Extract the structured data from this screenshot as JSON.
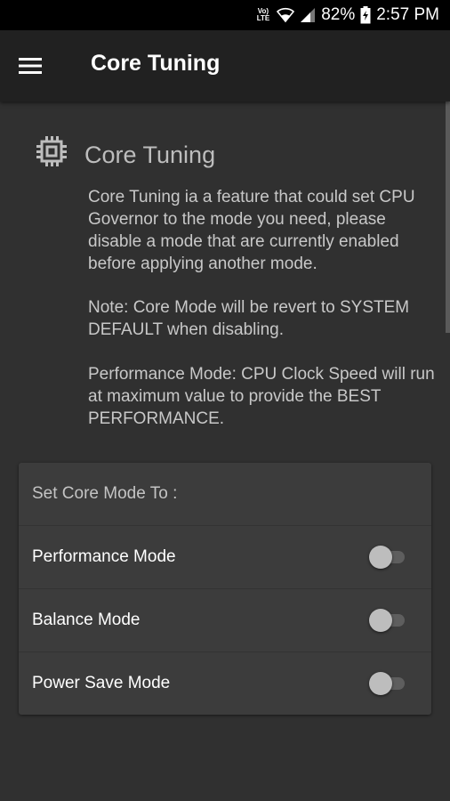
{
  "status_bar": {
    "volte_top": "Vo)",
    "volte_bottom": "LTE",
    "wifi_icon": "wifi-icon",
    "signal_icon": "signal-icon",
    "battery_percent": "82%",
    "battery_icon": "battery-charging-icon",
    "time": "2:57 PM"
  },
  "app_bar": {
    "menu_icon": "hamburger-menu-icon",
    "title": "Core Tuning"
  },
  "section": {
    "icon": "cpu-chip-icon",
    "title": "Core Tuning",
    "paragraphs": [
      "Core Tuning ia a feature that could set CPU Governor to the mode you need, please disable a mode that are currently enabled before applying another mode.",
      "Note: Core Mode will be revert to SYSTEM DEFAULT when disabling.",
      "Performance Mode: CPU Clock Speed will run at maximum value to provide the BEST PERFORMANCE."
    ]
  },
  "card": {
    "header": "Set Core Mode To :",
    "modes": [
      {
        "label": "Performance Mode",
        "enabled": false
      },
      {
        "label": "Balance Mode",
        "enabled": false
      },
      {
        "label": "Power Save Mode",
        "enabled": false
      }
    ]
  },
  "colors": {
    "background": "#303030",
    "app_bar": "#212121",
    "card": "#3c3c3c",
    "switch_thumb_off": "#bdbdbd",
    "switch_track_off": "#5e5e5e"
  }
}
